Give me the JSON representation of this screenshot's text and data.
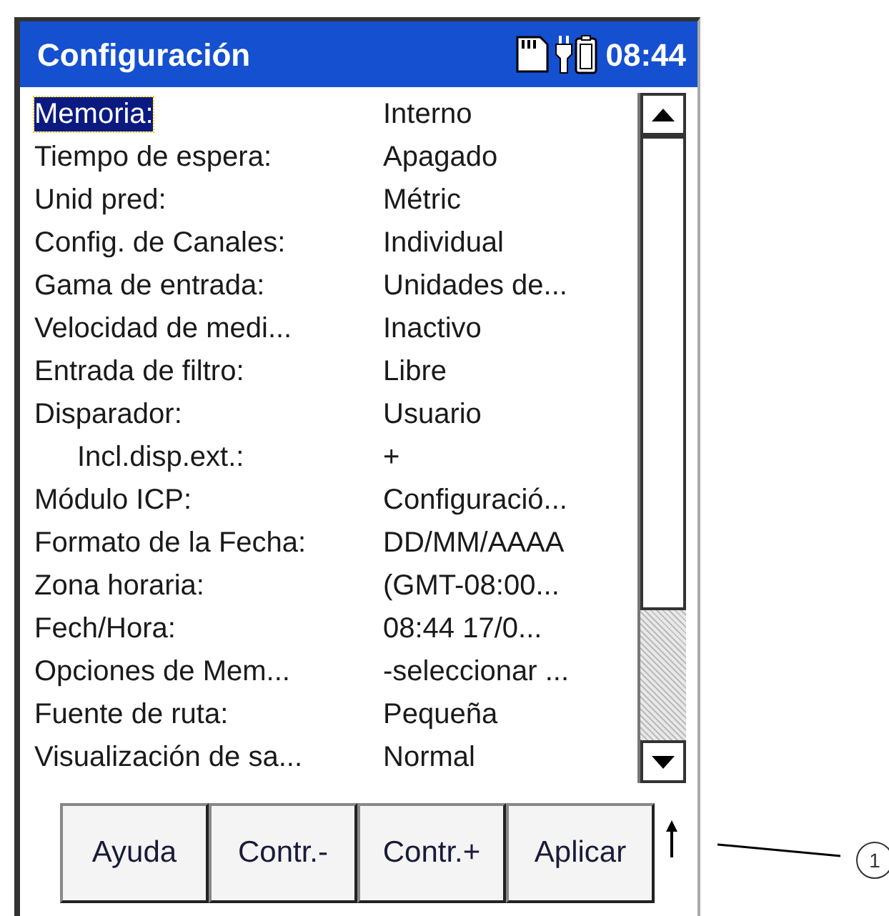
{
  "window": {
    "title": "Configuración",
    "time": "08:44"
  },
  "settings": [
    {
      "label": "Memoria:",
      "value": "Interno",
      "selected": true
    },
    {
      "label": "Tiempo de espera:",
      "value": "Apagado",
      "selected": false
    },
    {
      "label": "Unid pred:",
      "value": "Métric",
      "selected": false
    },
    {
      "label": "Config. de Canales:",
      "value": "Individual",
      "selected": false
    },
    {
      "label": "Gama de entrada:",
      "value": "Unidades de...",
      "selected": false
    },
    {
      "label": "Velocidad de medi...",
      "value": "Inactivo",
      "selected": false
    },
    {
      "label": "Entrada de filtro:",
      "value": "Libre",
      "selected": false
    },
    {
      "label": "Disparador:",
      "value": "Usuario",
      "selected": false,
      "children": [
        {
          "label": "Incl.disp.ext.:",
          "value": "+",
          "selected": false
        }
      ]
    },
    {
      "label": "Módulo ICP:",
      "value": "Configuració...",
      "selected": false
    },
    {
      "label": "Formato de la Fecha:",
      "value": "DD/MM/AAAA",
      "selected": false
    },
    {
      "label": "Zona horaria:",
      "value": "(GMT-08:00...",
      "selected": false
    },
    {
      "label": "Fech/Hora:",
      "value": "08:44 17/0...",
      "selected": false
    },
    {
      "label": "Opciones de Mem...",
      "value": "-seleccionar ...",
      "selected": false
    },
    {
      "label": "Fuente de ruta:",
      "value": "Pequeña",
      "selected": false
    },
    {
      "label": "Visualización de sa...",
      "value": "Normal",
      "selected": false
    }
  ],
  "buttons": [
    "Ayuda",
    "Contr.-",
    "Contr.+",
    "Aplicar"
  ],
  "callout": "1"
}
